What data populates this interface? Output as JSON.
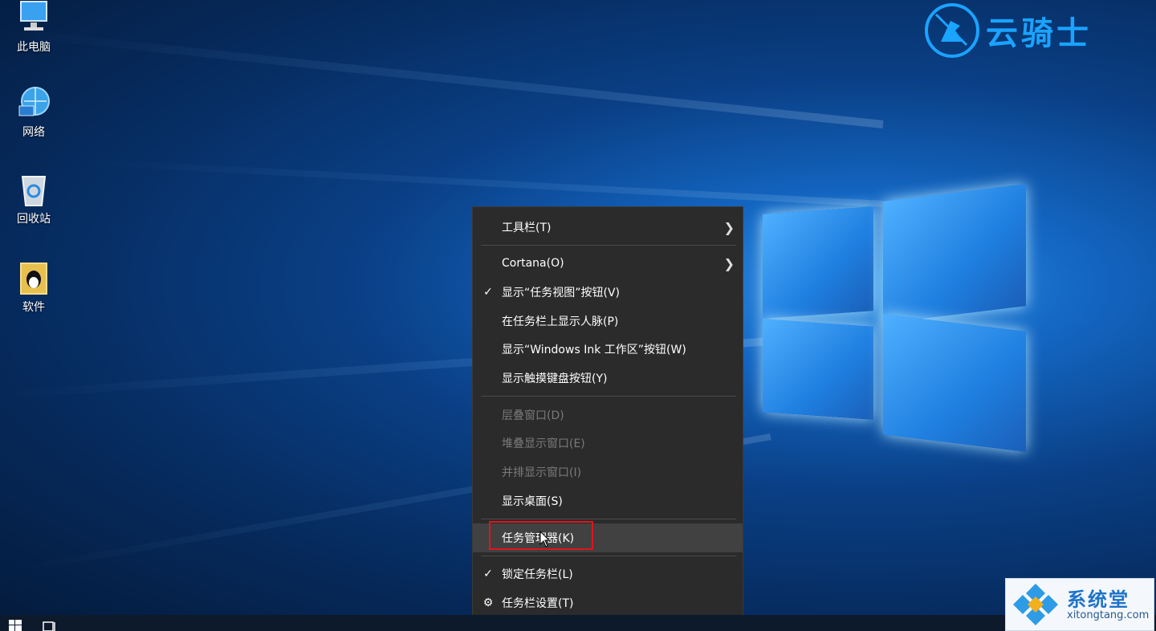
{
  "desktop": {
    "icons": [
      {
        "label": "此电脑",
        "icon": "computer-icon"
      },
      {
        "label": "网络",
        "icon": "network-globe-icon"
      },
      {
        "label": "回收站",
        "icon": "recycle-bin-icon"
      },
      {
        "label": "软件",
        "icon": "software-folder-icon"
      }
    ]
  },
  "logo": {
    "text": "云骑士",
    "icon": "knight-logo-icon",
    "color": "#1aa3ff"
  },
  "context_menu": {
    "items": [
      {
        "label": "工具栏(T)",
        "submenu": true
      },
      {
        "label": "Cortana(O)",
        "submenu": true
      },
      {
        "label": "显示“任务视图”按钮(V)",
        "checked": true
      },
      {
        "label": "在任务栏上显示人脉(P)"
      },
      {
        "label": "显示“Windows Ink 工作区”按钮(W)"
      },
      {
        "label": "显示触摸键盘按钮(Y)"
      },
      {
        "label": "层叠窗口(D)",
        "disabled": true
      },
      {
        "label": "堆叠显示窗口(E)",
        "disabled": true
      },
      {
        "label": "并排显示窗口(I)",
        "disabled": true
      },
      {
        "label": "显示桌面(S)"
      },
      {
        "label": "任务管理器(K)",
        "hovered": true
      },
      {
        "label": "锁定任务栏(L)",
        "checked": true
      },
      {
        "label": "任务栏设置(T)",
        "icon": "gear-icon"
      }
    ],
    "highlight_color": "#e0141e"
  },
  "taskbar": {
    "start_icon": "windows-start-icon",
    "task_view_icon": "task-view-icon"
  },
  "watermark": {
    "name": "系统堂",
    "url": "xitongtang.com"
  }
}
